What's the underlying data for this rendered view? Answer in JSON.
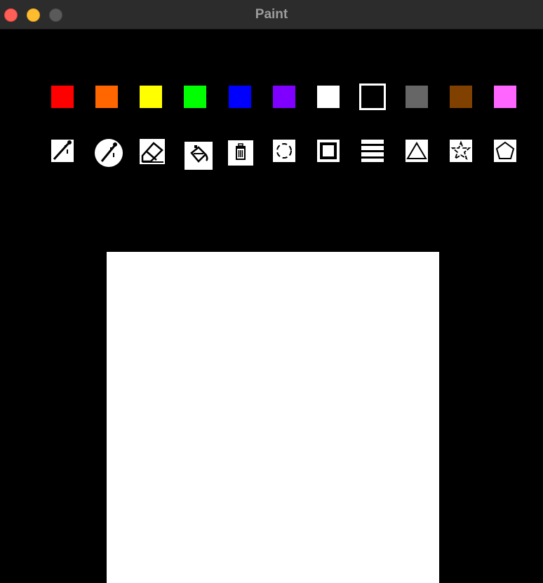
{
  "window": {
    "title": "Paint"
  },
  "palette": [
    {
      "name": "red",
      "color": "#ff0000"
    },
    {
      "name": "orange",
      "color": "#ff6600"
    },
    {
      "name": "yellow",
      "color": "#ffff00"
    },
    {
      "name": "green",
      "color": "#00ff00"
    },
    {
      "name": "blue",
      "color": "#0000ff"
    },
    {
      "name": "purple",
      "color": "#8000ff"
    },
    {
      "name": "white",
      "color": "#ffffff"
    },
    {
      "name": "black",
      "color": "#000000",
      "selected": true
    },
    {
      "name": "gray",
      "color": "#666666"
    },
    {
      "name": "brown",
      "color": "#804000"
    },
    {
      "name": "pink",
      "color": "#ff66ff"
    }
  ],
  "tools": [
    {
      "name": "pen-icon"
    },
    {
      "name": "brush-icon"
    },
    {
      "name": "eraser-icon"
    },
    {
      "name": "paint-bucket-icon"
    },
    {
      "name": "trash-icon"
    },
    {
      "name": "circle-icon"
    },
    {
      "name": "square-icon"
    },
    {
      "name": "line-thickness-icon"
    },
    {
      "name": "triangle-icon"
    },
    {
      "name": "star-icon"
    },
    {
      "name": "pentagon-icon"
    }
  ]
}
